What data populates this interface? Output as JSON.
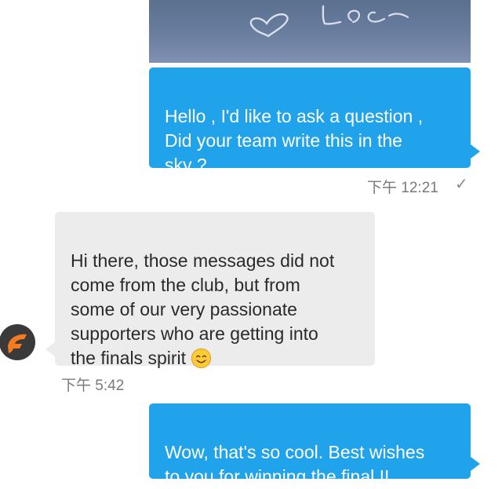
{
  "conversation": {
    "messages": [
      {
        "direction": "outgoing",
        "text": "Hello , I'd like to ask a question ,\nDid your team write this in the\nsky ?",
        "time": "下午 12:21",
        "status_icon": "check-icon"
      },
      {
        "direction": "incoming",
        "text": "Hi there, those messages did not\ncome from the club, but from\nsome of our very passionate\nsupporters who are getting into\nthe finals spirit",
        "emoji": "smiling-face-icon",
        "time": "下午 5:42",
        "avatar_icon": "orange-logo-icon"
      },
      {
        "direction": "outgoing",
        "text": "Wow, that's so cool. Best wishes\nto you for winning the final !!"
      }
    ]
  },
  "colors": {
    "outgoing_bubble": "#21a3ec",
    "incoming_bubble": "#ececec",
    "timestamp": "#7a7a7a",
    "avatar_orange": "#f47b20",
    "avatar_dark": "#3a3a3a"
  }
}
